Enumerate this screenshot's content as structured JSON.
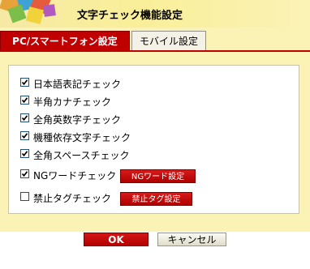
{
  "window": {
    "title": "文字チェック機能設定"
  },
  "tabs": [
    {
      "label": "PC/スマートフォン設定",
      "active": true
    },
    {
      "label": "モバイル設定",
      "active": false
    }
  ],
  "options": [
    {
      "label": "日本語表記チェック",
      "checked": true
    },
    {
      "label": "半角カナチェック",
      "checked": true
    },
    {
      "label": "全角英数字チェック",
      "checked": true
    },
    {
      "label": "機種依存文字チェック",
      "checked": true
    },
    {
      "label": "全角スペースチェック",
      "checked": true
    },
    {
      "label": "NGワードチェック",
      "checked": true,
      "button": "NGワード設定"
    },
    {
      "label": "禁止タグチェック",
      "checked": false,
      "button": "禁止タグ設定"
    }
  ],
  "footer": {
    "ok_label": "OK",
    "cancel_label": "キャンセル"
  },
  "colors": {
    "accent": "#c00000",
    "panel_background": "#fbf2b6"
  },
  "icons": {
    "app": "colorful-blocks-icon",
    "checkbox": "checkmark-icon"
  }
}
